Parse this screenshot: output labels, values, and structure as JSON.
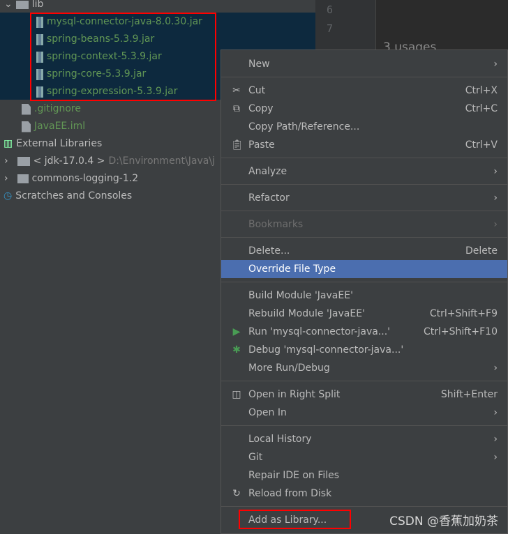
{
  "tree": {
    "lib": "lib",
    "jars": [
      "mysql-connector-java-8.0.30.jar",
      "spring-beans-5.3.9.jar",
      "spring-context-5.3.9.jar",
      "spring-core-5.3.9.jar",
      "spring-expression-5.3.9.jar"
    ],
    "gitignore": ".gitignore",
    "iml": "JavaEE.iml",
    "external": "External Libraries",
    "jdk": "< jdk-17.0.4 >",
    "jdk_path": "D:\\Environment\\Java\\j",
    "commons": "commons-logging-1.2",
    "scratches": "Scratches and Consoles"
  },
  "gutter": {
    "lines": [
      "6",
      "7"
    ]
  },
  "editor": {
    "usages": "3 usages"
  },
  "menu": {
    "new": "New",
    "cut": "Cut",
    "cut_sc": "Ctrl+X",
    "copy": "Copy",
    "copy_sc": "Ctrl+C",
    "copy_path": "Copy Path/Reference...",
    "paste": "Paste",
    "paste_sc": "Ctrl+V",
    "analyze": "Analyze",
    "refactor": "Refactor",
    "bookmarks": "Bookmarks",
    "delete": "Delete...",
    "delete_sc": "Delete",
    "override": "Override File Type",
    "build": "Build Module 'JavaEE'",
    "rebuild": "Rebuild Module 'JavaEE'",
    "rebuild_sc": "Ctrl+Shift+F9",
    "run": "Run 'mysql-connector-java...'",
    "run_sc": "Ctrl+Shift+F10",
    "debug": "Debug 'mysql-connector-java...'",
    "more_run": "More Run/Debug",
    "right_split": "Open in Right Split",
    "right_split_sc": "Shift+Enter",
    "open_in": "Open In",
    "local_history": "Local History",
    "git": "Git",
    "repair": "Repair IDE on Files",
    "reload": "Reload from Disk",
    "add_library": "Add as Library..."
  },
  "watermark": "CSDN @香蕉加奶茶"
}
